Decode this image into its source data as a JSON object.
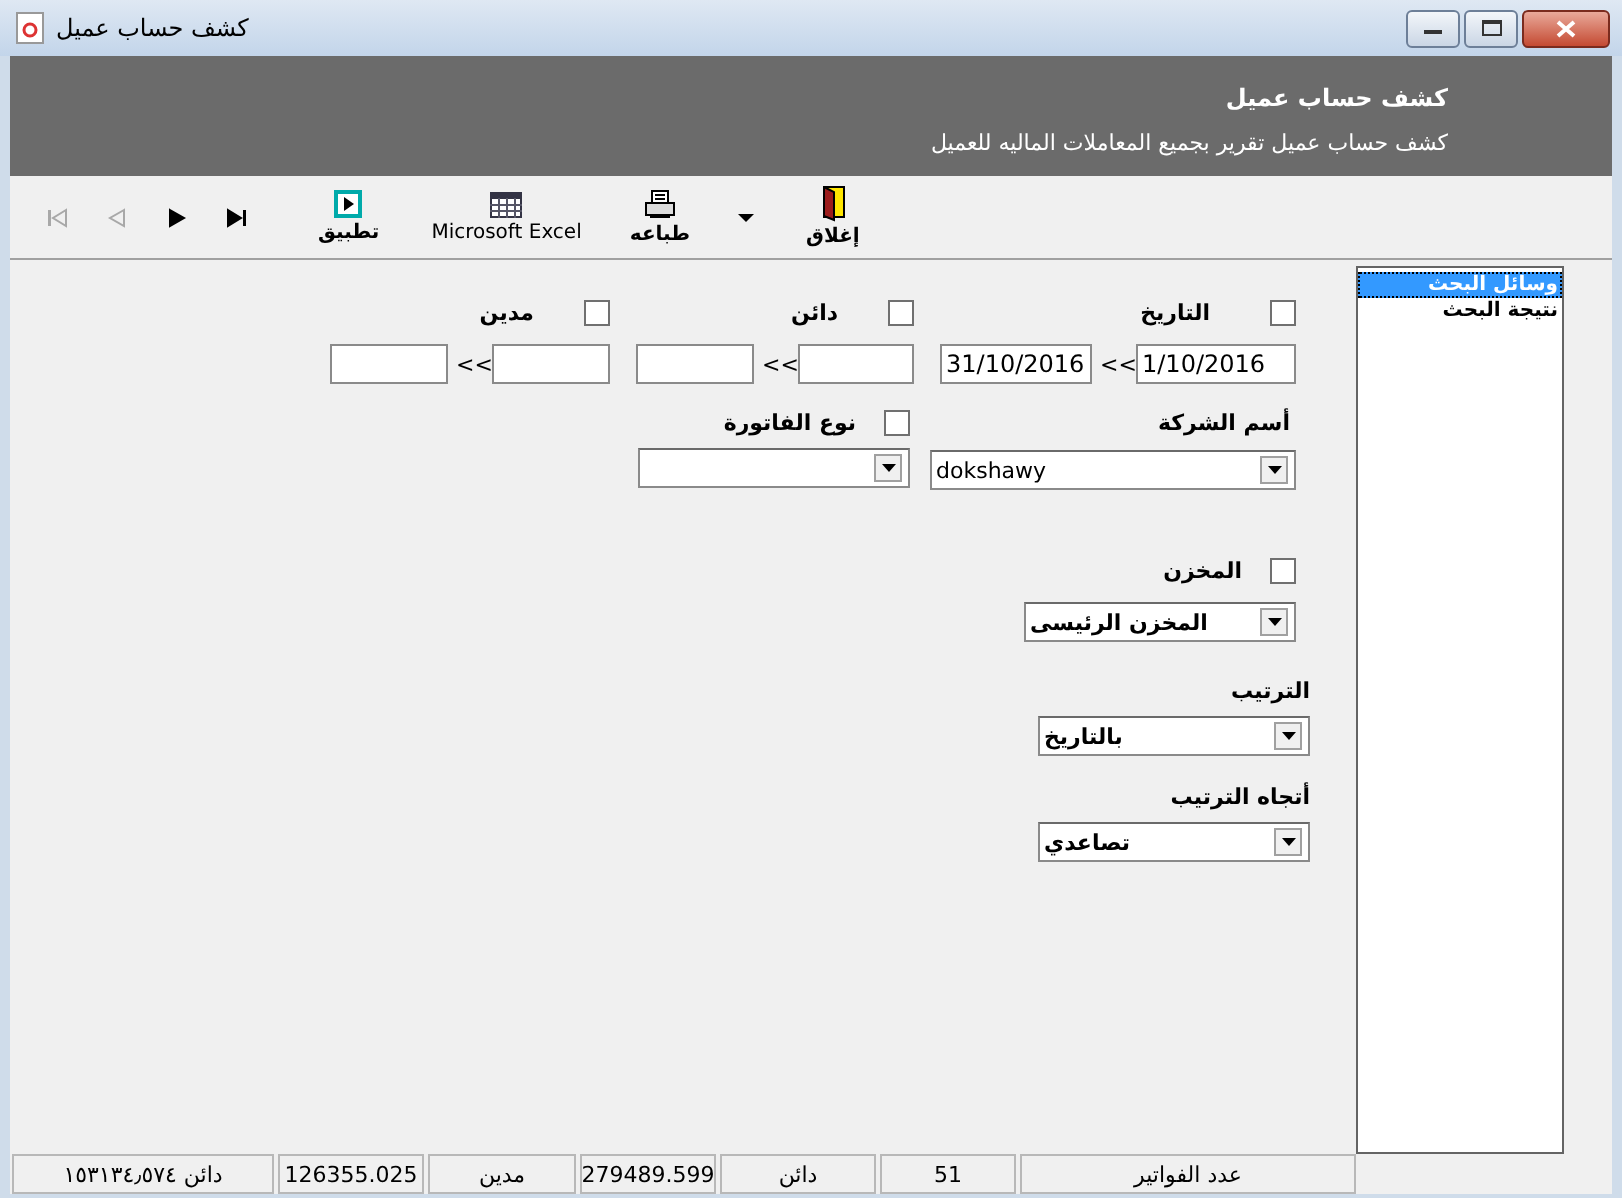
{
  "window": {
    "title": "كشف حساب عميل"
  },
  "header": {
    "title": "كشف حساب عميل",
    "subtitle": "كشف حساب عميل تقرير بجميع المعاملات الماليه للعميل"
  },
  "toolbar": {
    "nav": [
      {
        "kind": "first",
        "disabled": true
      },
      {
        "kind": "previous",
        "disabled": true
      },
      {
        "kind": "next",
        "disabled": false
      },
      {
        "kind": "last",
        "disabled": false
      }
    ],
    "buttons": [
      {
        "kind": "close",
        "label": "إغلاق"
      },
      {
        "kind": "dropdown"
      },
      {
        "kind": "print",
        "label": "طباعه"
      },
      {
        "kind": "excel",
        "label": "Microsoft Excel"
      },
      {
        "kind": "apply",
        "label": "تطبيق"
      }
    ]
  },
  "filters": [
    {
      "label": "التاريخ",
      "checked": false,
      "from": "1/10/2016",
      "range_separator": "<<",
      "to": "31/10/2016"
    },
    {
      "label": "دائن",
      "checked": false,
      "range_separator": "<<"
    },
    {
      "label": "مدين",
      "checked": false,
      "range_separator": "<<"
    }
  ],
  "company": {
    "label": "أسم الشركة",
    "value": "dokshawy"
  },
  "invoice_type": {
    "label": "نوع الفاتورة",
    "checked": false
  },
  "store": {
    "label": "المخزن",
    "checked": false,
    "value": "المخزن الرئيسى"
  },
  "sort": {
    "label": "الترتيب",
    "value": "بالتاريخ"
  },
  "sort_direction": {
    "label": "أتجاه الترتيب",
    "value": "تصاعدي"
  },
  "side_panel": {
    "items": [
      {
        "label": "وسائل البحث",
        "selected": true
      },
      {
        "label": "نتيجة البحث",
        "selected": false
      }
    ]
  },
  "status_bar": [
    "عدد الفواتير",
    "51",
    "دائن",
    "279489.599",
    "مدين",
    "126355.025",
    "دائن ١٥٣١٣٤٫٥٧٤"
  ]
}
